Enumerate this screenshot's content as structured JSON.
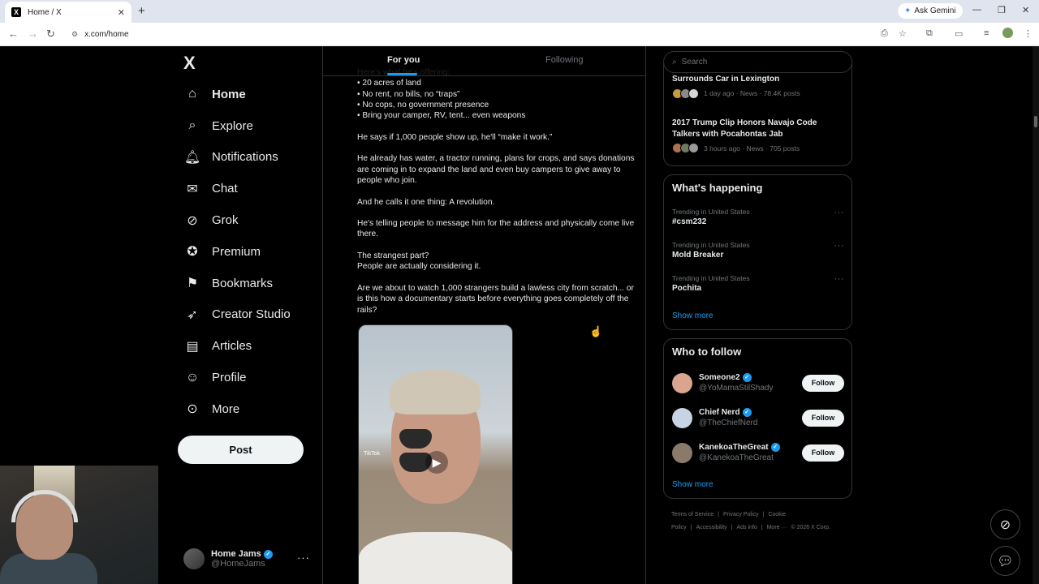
{
  "browser": {
    "tab_title": "Home / X",
    "tab_favicon": "X",
    "url": "x.com/home",
    "ask_gemini": "Ask Gemini"
  },
  "nav": {
    "logo": "X",
    "items": [
      {
        "label": "Home",
        "icon": "home-icon",
        "glyph": "⌂"
      },
      {
        "label": "Explore",
        "icon": "search-icon",
        "glyph": "⌕"
      },
      {
        "label": "Notifications",
        "icon": "bell-icon",
        "glyph": "🔔︎"
      },
      {
        "label": "Chat",
        "icon": "mail-icon",
        "glyph": "✉"
      },
      {
        "label": "Grok",
        "icon": "grok-icon",
        "glyph": "⊘"
      },
      {
        "label": "Premium",
        "icon": "verified-badge-icon",
        "glyph": "✪"
      },
      {
        "label": "Bookmarks",
        "icon": "bookmark-icon",
        "glyph": "⚑"
      },
      {
        "label": "Creator Studio",
        "icon": "rocket-icon",
        "glyph": "➶"
      },
      {
        "label": "Articles",
        "icon": "article-icon",
        "glyph": "▤"
      },
      {
        "label": "Profile",
        "icon": "person-icon",
        "glyph": "☺"
      },
      {
        "label": "More",
        "icon": "more-circle-icon",
        "glyph": "⊙"
      }
    ],
    "post_label": "Post"
  },
  "account": {
    "name": "Home Jams",
    "handle": "@HomeJams"
  },
  "feed": {
    "tabs": [
      "For you",
      "Following"
    ],
    "tweet_paragraphs": [
      {
        "lines": [
          "Here's what he's offering:",
          "• 20 acres of land",
          "• No rent, no bills, no “traps”",
          "• No cops, no government presence",
          "• Bring your camper, RV, tent... even weapons"
        ]
      },
      {
        "lines": [
          "He says if 1,000 people show up, he'll “make it work.”"
        ]
      },
      {
        "lines": [
          "He already has water, a tractor running, plans for crops, and says donations are coming in to expand the land and even buy campers to give away to people who join."
        ]
      },
      {
        "lines": [
          "And he calls it one thing: A revolution."
        ]
      },
      {
        "lines": [
          "He's telling people to message him for the address and physically come live there."
        ]
      },
      {
        "lines": [
          "The strangest part?",
          "People are actually considering it."
        ]
      },
      {
        "lines": [
          "Are we about to watch 1,000 strangers build a lawless city from scratch... or is this how a documentary starts before everything goes completely off the rails?"
        ]
      }
    ],
    "media_watermark": "TikTok"
  },
  "right": {
    "search_placeholder": "Search",
    "news": [
      {
        "title": "Surrounds Car in Lexington",
        "meta": "1 day ago · News · 78.4K posts",
        "colors": [
          "#c99a3a",
          "#8a8a8a",
          "#d6d6d6"
        ]
      },
      {
        "title": "2017 Trump Clip Honors Navajo Code Talkers with Pocahontas Jab",
        "meta": "3 hours ago · News · 705 posts",
        "colors": [
          "#b07050",
          "#6b7b5b",
          "#9a9a9a"
        ]
      }
    ],
    "whats_happening": {
      "title": "What's happening",
      "trends": [
        {
          "context": "Trending in United States",
          "name": "#csm232"
        },
        {
          "context": "Trending in United States",
          "name": "Mold Breaker"
        },
        {
          "context": "Trending in United States",
          "name": "Pochita"
        }
      ],
      "show_more": "Show more"
    },
    "who_to_follow": {
      "title": "Who to follow",
      "accounts": [
        {
          "name": "Someone2",
          "handle": "@YoMamaStilShady",
          "follow": "Follow",
          "color": "#d9a58f"
        },
        {
          "name": "Chief Nerd",
          "handle": "@TheChiefNerd",
          "follow": "Follow",
          "color": "#c6d4e3"
        },
        {
          "name": "KanekoaTheGreat",
          "handle": "@KanekoaTheGreat",
          "follow": "Follow",
          "color": "#8a7a6a"
        }
      ],
      "show_more": "Show more"
    },
    "footer_links": [
      "Terms of Service",
      "|",
      "Privacy Policy",
      "|",
      "Cookie Policy",
      "|",
      "Accessibility",
      "|",
      "Ads info",
      "|",
      "More ···",
      "© 2026 X Corp."
    ]
  }
}
